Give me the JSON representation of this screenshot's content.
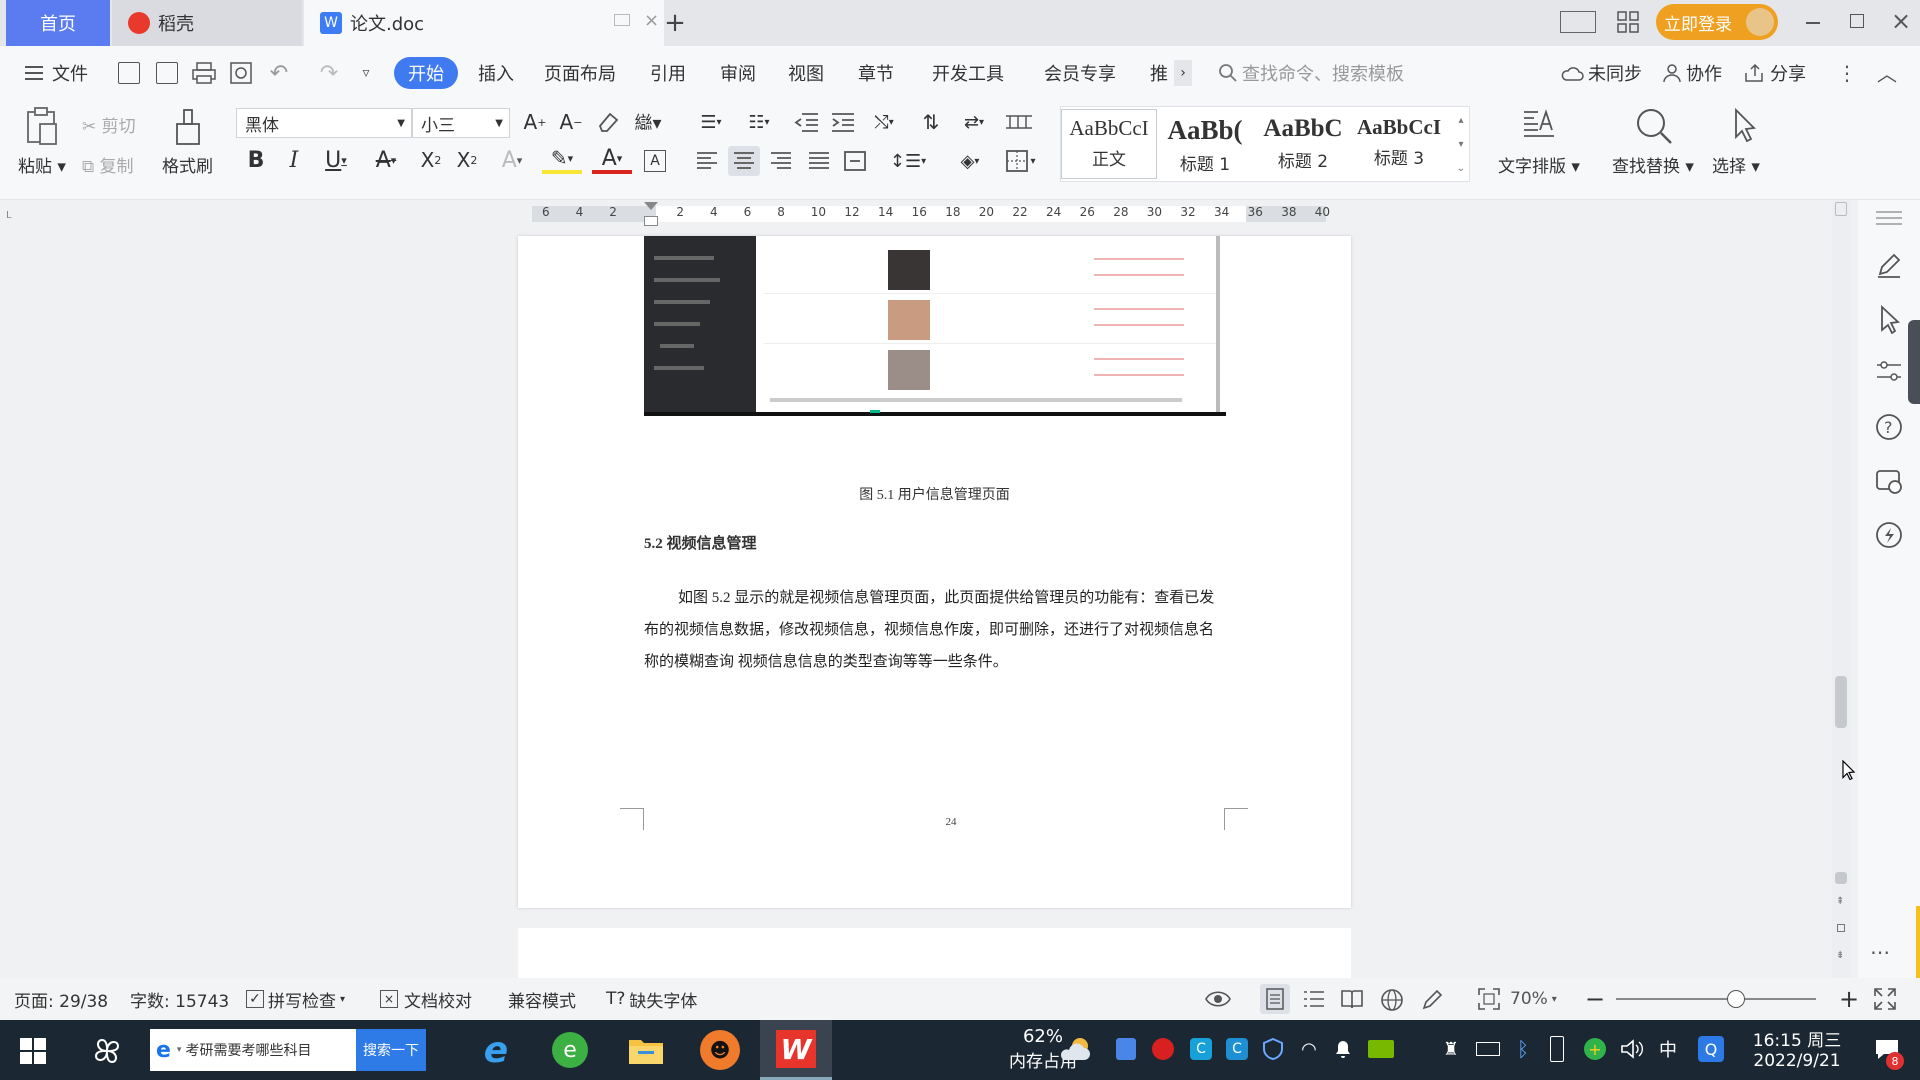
{
  "tabs": {
    "home": "首页",
    "daoke": "稻壳",
    "doc": "论文.doc"
  },
  "window": {
    "login_label": "立即登录"
  },
  "menu": {
    "file": "文件",
    "items": [
      "开始",
      "插入",
      "页面布局",
      "引用",
      "审阅",
      "视图",
      "章节",
      "开发工具",
      "会员专享",
      "推"
    ],
    "search_placeholder": "查找命令、搜索模板",
    "unsync": "未同步",
    "collab": "协作",
    "share": "分享"
  },
  "toolbar": {
    "paste": "粘贴",
    "cut": "剪切",
    "copy": "复制",
    "format_painter": "格式刷",
    "font_name": "黑体",
    "font_size": "小三",
    "styles": [
      {
        "preview": "AaBbCcI",
        "label": "正文"
      },
      {
        "preview": "AaBb(",
        "label": "标题 1"
      },
      {
        "preview": "AaBbC",
        "label": "标题 2"
      },
      {
        "preview": "AaBbCcI",
        "label": "标题 3"
      }
    ],
    "text_layout": "文字排版",
    "find_replace": "查找替换",
    "select": "选择"
  },
  "ruler": {
    "ticks": [
      "6",
      "4",
      "2",
      "",
      "2",
      "4",
      "6",
      "8",
      "10",
      "12",
      "14",
      "16",
      "18",
      "20",
      "22",
      "24",
      "26",
      "28",
      "30",
      "32",
      "34",
      "36",
      "38",
      "40"
    ]
  },
  "document": {
    "caption": "图 5.1  用户信息管理页面",
    "heading": "5.2  视频信息管理",
    "paragraph": "如图 5.2 显示的就是视频信息管理页面，此页面提供给管理员的功能有：查看已发布的视频信息数据，修改视频信息，视频信息作废，即可删除，还进行了对视频信息名称的模糊查询  视频信息信息的类型查询等等一些条件。",
    "page_number": "24"
  },
  "status": {
    "page": "页面: 29/38",
    "words": "字数: 15743",
    "spell_check": "拼写检查",
    "doc_check": "文档校对",
    "compat": "兼容模式",
    "missing_font": "缺失字体",
    "zoom": "70%",
    "zoom_level": 0.7
  },
  "taskbar": {
    "search_text": "考研需要考哪些科目",
    "search_button": "搜索一下",
    "memory_percent": "62%",
    "memory_label": "内存占用",
    "ime": "中",
    "time": "16:15 周三",
    "date": "2022/9/21",
    "notification_count": "8"
  }
}
